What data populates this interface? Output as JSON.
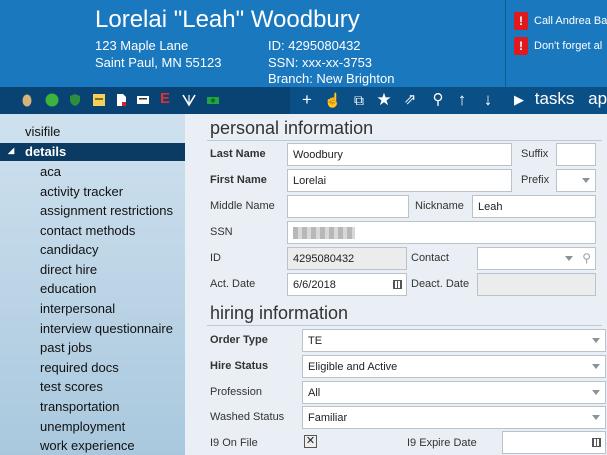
{
  "header": {
    "name": "Lorelai \"Leah\" Woodbury",
    "address_line1": "123 Maple Lane",
    "address_line2": "Saint Paul, MN 55123",
    "id_line": "ID: 4295080432",
    "ssn_line": "SSN:  xxx-xx-3753",
    "branch_line": "Branch:  New Brighton",
    "alerts": [
      "Call Andrea Ba",
      "Don't forget al"
    ]
  },
  "toolbar": {
    "tasks_label": "tasks",
    "next_label": "ap"
  },
  "sidebar": {
    "top_item": "visifile",
    "selected_item": "details",
    "items": [
      "aca",
      "activity tracker",
      "assignment restrictions",
      "contact methods",
      "candidacy",
      "direct hire",
      "education",
      "interpersonal",
      "interview questionnaire",
      "past jobs",
      "required docs",
      "test scores",
      "transportation",
      "unemployment",
      "work experience"
    ]
  },
  "personal": {
    "title": "personal information",
    "last_name_label": "Last Name",
    "last_name": "Woodbury",
    "suffix_label": "Suffix",
    "first_name_label": "First Name",
    "first_name": "Lorelai",
    "prefix_label": "Prefix",
    "middle_name_label": "Middle Name",
    "nickname_label": "Nickname",
    "nickname": "Leah",
    "ssn_label": "SSN",
    "id_label": "ID",
    "id_value": "4295080432",
    "contact_label": "Contact",
    "act_date_label": "Act. Date",
    "act_date": "6/6/2018",
    "deact_date_label": "Deact. Date"
  },
  "hiring": {
    "title": "hiring information",
    "order_type_label": "Order Type",
    "order_type": "TE",
    "hire_status_label": "Hire Status",
    "hire_status": "Eligible and Active",
    "profession_label": "Profession",
    "profession": "All",
    "washed_status_label": "Washed Status",
    "washed_status": "Familiar",
    "i9_on_file_label": "I9 On File",
    "i9_on_file": true,
    "i9_expire_label": "I9 Expire Date"
  }
}
